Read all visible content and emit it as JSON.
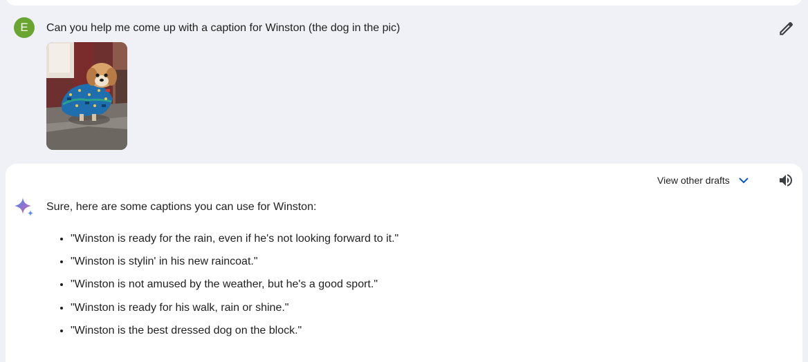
{
  "user_message": {
    "avatar_letter": "E",
    "avatar_color": "#6aa532",
    "text": "Can you help me come up with a caption for Winston (the dog in the pic)",
    "edit_icon": "pencil-icon",
    "image_subject": "small fluffy dog wearing a blue patterned raincoat"
  },
  "response": {
    "drafts_label": "View other drafts",
    "drafts_icon": "chevron-down-icon",
    "speaker_icon": "speaker-icon",
    "assistant_icon": "sparkle-icon",
    "intro": "Sure, here are some captions you can use for Winston:",
    "captions": [
      "\"Winston is ready for the rain, even if he's not looking forward to it.\"",
      "\"Winston is stylin' in his new raincoat.\"",
      "\"Winston is not amused by the weather, but he's a good sport.\"",
      "\"Winston is ready for his walk, rain or shine.\"",
      "\"Winston is the best dressed dog on the block.\""
    ]
  },
  "colors": {
    "page_background": "#f0f1f6",
    "card_background": "#ffffff",
    "accent_blue": "#0b57d0"
  }
}
